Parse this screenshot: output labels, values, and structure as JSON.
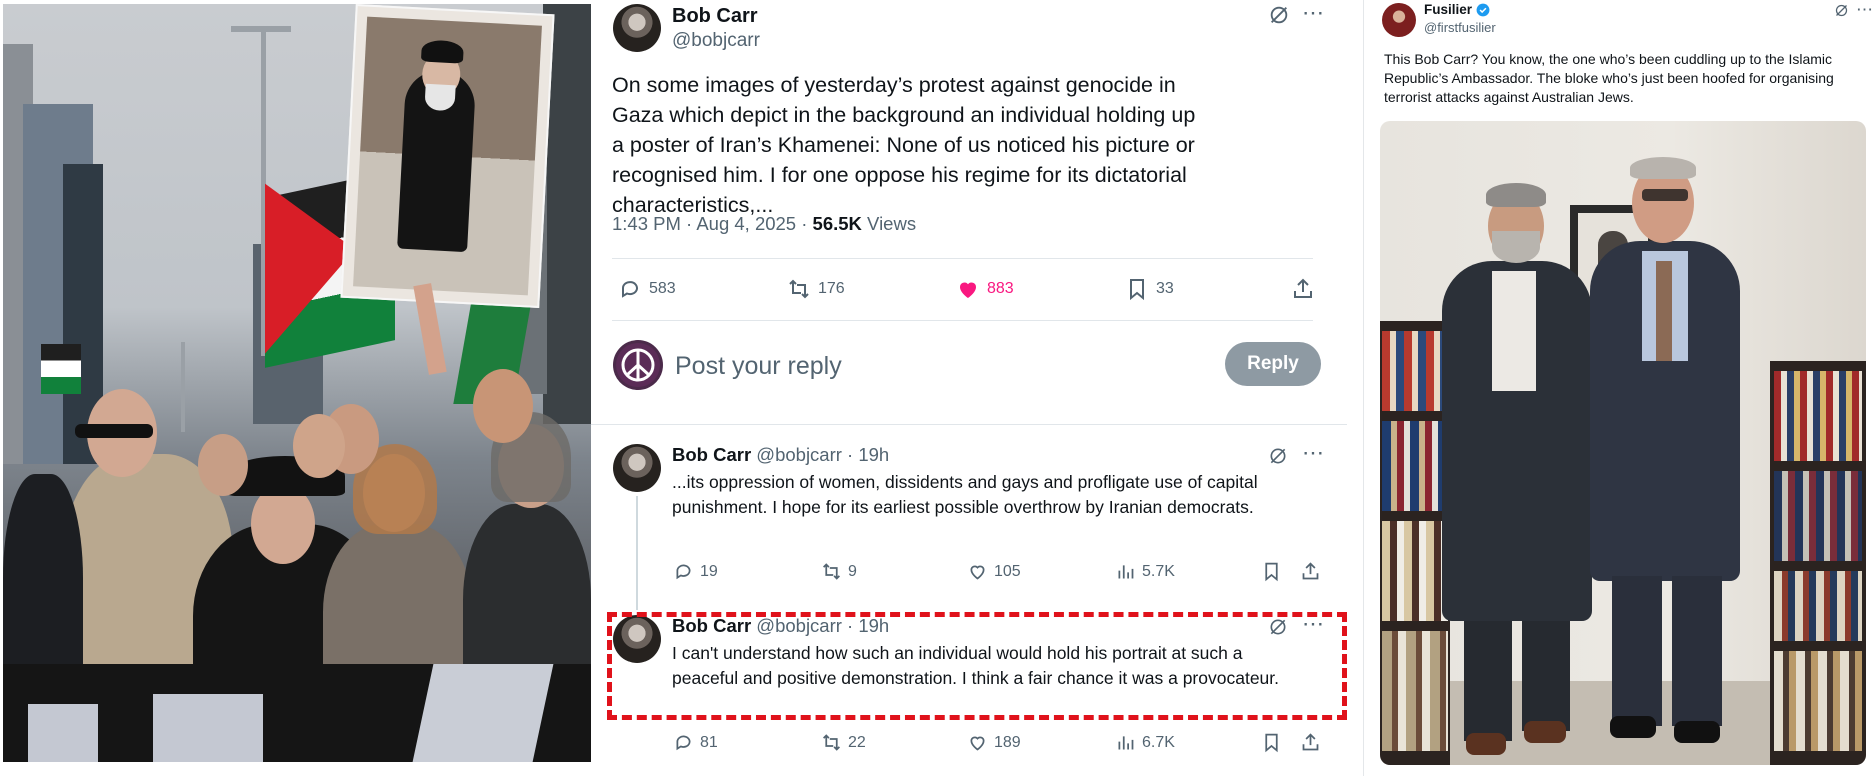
{
  "main_tweet": {
    "author_name": "Bob Carr",
    "author_handle": "@bobjcarr",
    "text": "On some images of yesterday’s protest against genocide in Gaza which depict in the background an individual holding up a poster of Iran’s Khamenei: None of us noticed his picture or recognised him. I for one oppose his regime for its dictatorial characteristics,...",
    "timestamp": "1:43 PM · Aug 4, 2025 · ",
    "views_count": "56.5K",
    "views_label": " Views",
    "replies": "583",
    "reposts": "176",
    "likes": "883",
    "bookmarks": "33",
    "reply_placeholder": "Post your reply",
    "reply_button": "Reply",
    "like_color": "#f91880",
    "icons": [
      "grok-icon",
      "more-icon",
      "reply-icon",
      "repost-icon",
      "heart-icon",
      "bookmark-icon",
      "share-icon"
    ]
  },
  "replies": [
    {
      "author_name": "Bob Carr",
      "author_handle": "@bobjcarr · 19h",
      "text": "...its oppression of women, dissidents and gays and profligate use of capital punishment. I hope for its earliest possible overthrow by Iranian democrats.",
      "replies": "19",
      "reposts": "9",
      "likes": "105",
      "views": "5.7K"
    },
    {
      "author_name": "Bob Carr",
      "author_handle": "@bobjcarr · 19h",
      "text": "I can't understand how such an individual would hold his portrait at such a peaceful and positive demonstration. I think a fair chance it was a provocateur.",
      "replies": "81",
      "reposts": "22",
      "likes": "189",
      "views": "6.7K"
    }
  ],
  "quote_tweet": {
    "author_name": "Fusilier",
    "author_handle": "@firstfusilier",
    "verified_color": "#1d9bf0",
    "text": "This Bob Carr?  You know, the one who’s been cuddling up to the Islamic Republic’s Ambassador.  The bloke who’s just been hoofed for organising terrorist attacks against Australian Jews."
  },
  "highlight_color": "#e0121b"
}
